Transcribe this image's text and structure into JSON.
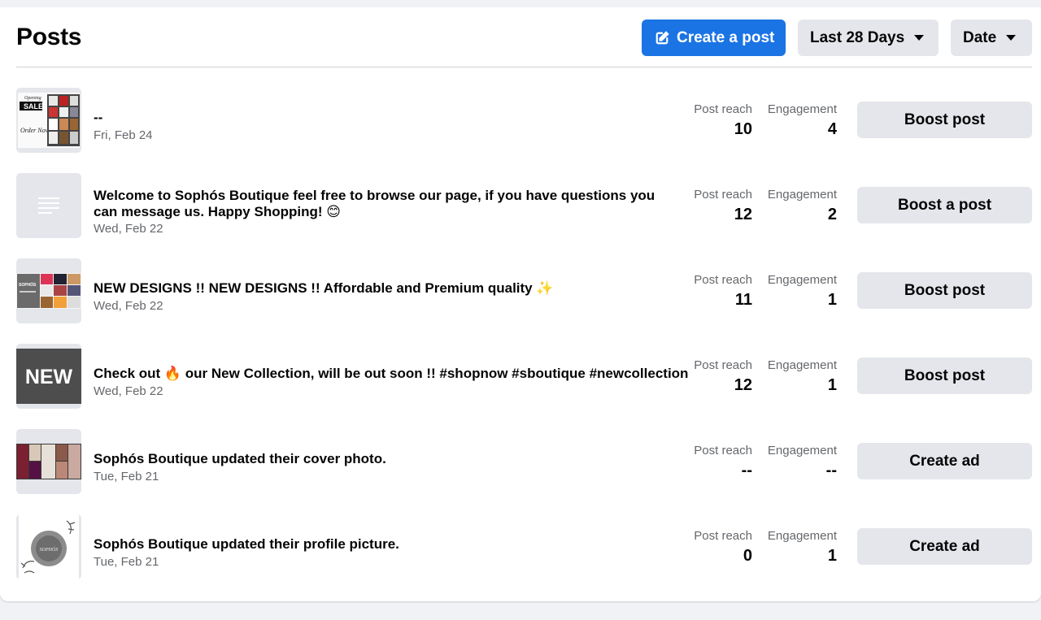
{
  "header": {
    "title": "Posts",
    "create_post_label": "Create a post",
    "range_label": "Last 28 Days",
    "sort_label": "Date"
  },
  "metric_labels": {
    "reach": "Post reach",
    "engagement": "Engagement"
  },
  "posts": [
    {
      "text": "--",
      "date": "Fri, Feb 24",
      "reach": "10",
      "engagement": "4",
      "action": "Boost post",
      "thumb": "sale-collage"
    },
    {
      "text": "Welcome to Sophós Boutique feel free to browse our page, if you have questions you can message us. Happy Shopping! 😊",
      "date": "Wed, Feb 22",
      "reach": "12",
      "engagement": "2",
      "action": "Boost a post",
      "thumb": "text-lines"
    },
    {
      "text": "NEW DESIGNS !! NEW DESIGNS !! Affordable and Premium quality ✨",
      "date": "Wed, Feb 22",
      "reach": "11",
      "engagement": "1",
      "action": "Boost post",
      "thumb": "designs-collage"
    },
    {
      "text": "Check out 🔥 our New Collection, will be out soon !! #shopnow #sboutique #newcollection",
      "date": "Wed, Feb 22",
      "reach": "12",
      "engagement": "1",
      "action": "Boost post",
      "thumb": "new-badge"
    },
    {
      "text": "Sophós Boutique updated their cover photo.",
      "date": "Tue, Feb 21",
      "reach": "--",
      "engagement": "--",
      "action": "Create ad",
      "thumb": "cover-collage"
    },
    {
      "text": "Sophós Boutique updated their profile picture.",
      "date": "Tue, Feb 21",
      "reach": "0",
      "engagement": "1",
      "action": "Create ad",
      "thumb": "profile-logo"
    }
  ],
  "thumb_texts": {
    "sale_top": "Opening",
    "sale_big": "SALE",
    "order_now": "Order Now",
    "designs_brand": "SOPHÓS",
    "new_badge": "NEW",
    "profile_brand": "SOPHÓS"
  },
  "colors": {
    "primary": "#1b74e4",
    "button_gray": "#e4e6eb",
    "secondary_text": "#65676b"
  }
}
